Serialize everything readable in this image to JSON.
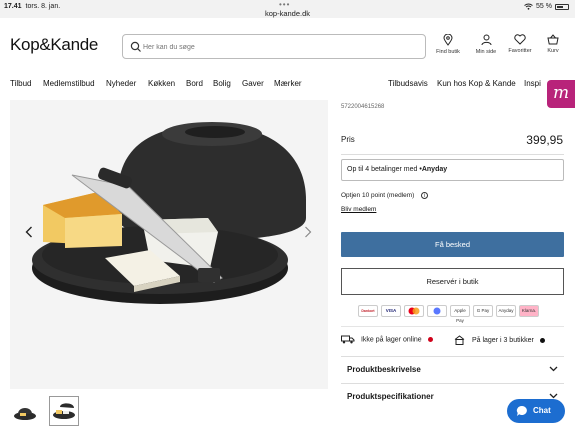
{
  "status_bar": {
    "time": "17.41",
    "date": "tors. 8. jan.",
    "dots": "•••",
    "url": "kop-kande.dk",
    "battery": "55 %"
  },
  "header": {
    "logo": "Kop&Kande",
    "search_placeholder": "Her kan du søge",
    "icons": [
      {
        "label": "Find butik",
        "icon": "location-pin-icon"
      },
      {
        "label": "Min side",
        "icon": "user-icon"
      },
      {
        "label": "Favoritter",
        "icon": "heart-icon"
      },
      {
        "label": "Kurv",
        "icon": "basket-icon"
      }
    ]
  },
  "nav": {
    "left": [
      "Tilbud",
      "Medlemstilbud",
      "Nyheder",
      "Køkken",
      "Bord",
      "Bolig",
      "Gaver",
      "Mærker"
    ],
    "right": [
      "Tilbudsavis",
      "Kun hos Kop & Kande",
      "Inspi"
    ],
    "badge": "m"
  },
  "product": {
    "sku": "5722004615268",
    "price_label": "Pris",
    "price": "399,95",
    "anyday_text": "Op til 4 betalinger med",
    "anyday_brand": "•Anyday",
    "points": "Optjen 10 point (medlem)",
    "member_link": "Bliv medlem",
    "primary_button": "Få besked",
    "secondary_button": "Reservér i butik",
    "payments": [
      "Dankort",
      "VISA",
      "MC",
      "MobilePay",
      "Apple Pay",
      "G Pay",
      "Anyday",
      "Klarna."
    ],
    "stock_online": "Ikke på lager online",
    "stock_store": "På lager i 3 butikker",
    "accordions": [
      "Produktbeskrivelse",
      "Produktspecifikationer"
    ]
  },
  "chat_label": "Chat",
  "colors": {
    "primary_button": "#3e6f9f",
    "brand_accent": "#b8237a",
    "chat": "#1c6dd0",
    "stock_out": "#d0021b",
    "stock_in": "#111111"
  }
}
